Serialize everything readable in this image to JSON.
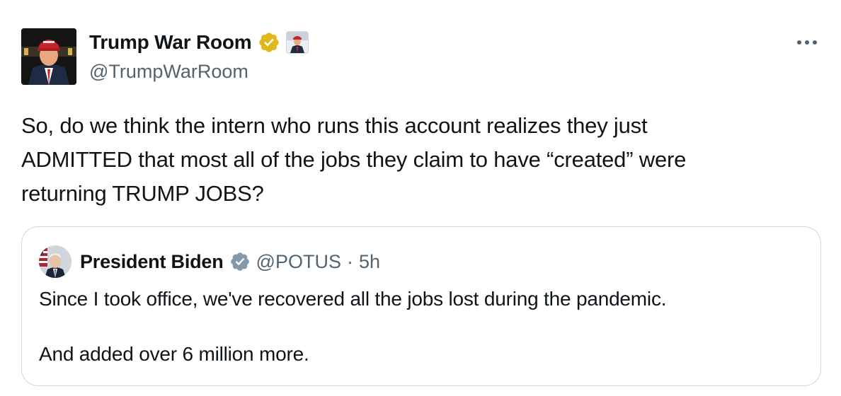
{
  "author": {
    "display_name": "Trump War Room",
    "handle": "@TrumpWarRoom",
    "avatar_icon": "profile-photo-man-red-cap",
    "verified_badge_icon": "gold-verified-badge",
    "verified_color": "#e2b719",
    "affiliate_icon": "affiliate-photo"
  },
  "more_icon": "ellipsis-icon",
  "tweet": {
    "text_lines": [
      "So, do we think the intern who runs this account realizes they just",
      "ADMITTED that most all of the jobs they claim to have “created” were",
      "returning TRUMP JOBS?"
    ]
  },
  "quoted": {
    "display_name": "President Biden",
    "handle": "@POTUS",
    "separator": "·",
    "time": "5h",
    "avatar_icon": "profile-photo-man-flag",
    "verified_badge_icon": "gray-verified-badge",
    "verified_color": "#829aab",
    "text_lines": [
      "Since I took office, we've recovered all the jobs lost during the pandemic.",
      "And added over 6 million more."
    ]
  }
}
